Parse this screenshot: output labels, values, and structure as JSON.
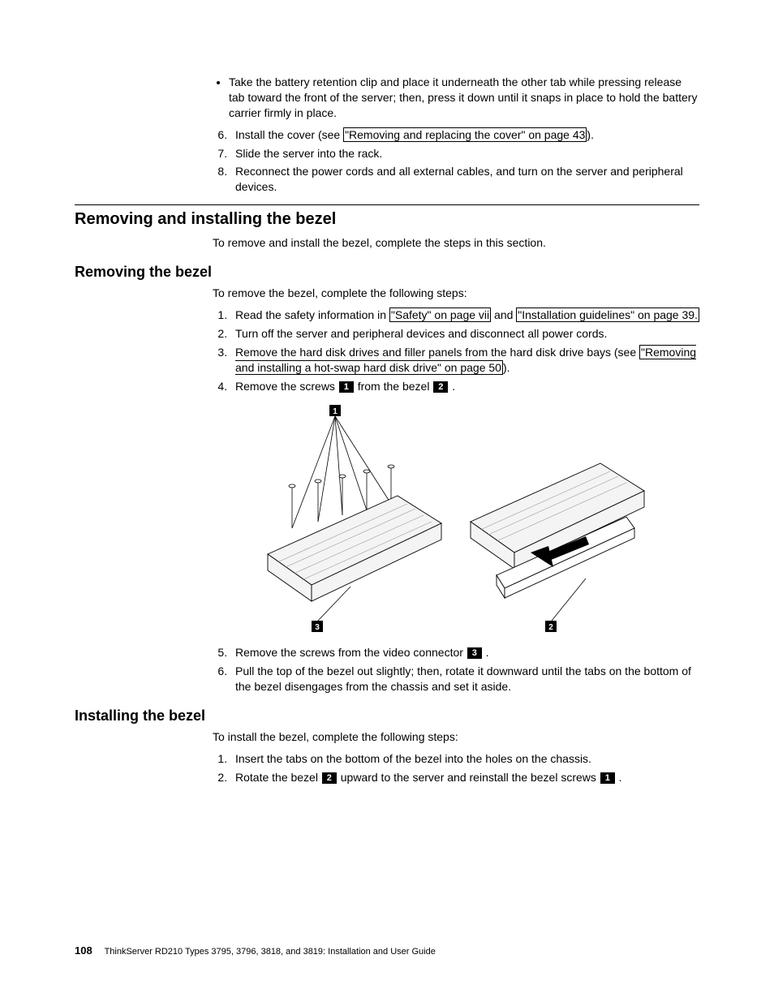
{
  "top": {
    "bullet": "Take the battery retention clip and place it underneath the other tab while pressing release tab toward the front of the server; then, press it down until it snaps in place to hold the battery carrier firmly in place.",
    "step6_a": "Install the cover (see ",
    "step6_link": "\"Removing and replacing the cover\" on page 43",
    "step6_b": ").",
    "step7": "Slide the server into the rack.",
    "step8": "Reconnect the power cords and all external cables, and turn on the server and peripheral devices."
  },
  "sec1": {
    "title": "Removing and installing the bezel",
    "intro": "To remove and install the bezel, complete the steps in this section."
  },
  "sec2": {
    "title": "Removing the bezel",
    "intro": "To remove the bezel, complete the following steps:",
    "s1_a": "Read the safety information in ",
    "s1_link1": "\"Safety\" on page vii",
    "s1_mid": " and ",
    "s1_link2": "\"Installation guidelines\" on page 39.",
    "s2": "Turn off the server and peripheral devices and disconnect all power cords.",
    "s3_a": "Remove the hard disk drives and filler panels from the hard disk drive bays (see ",
    "s3_link": "\"Removing and installing a hot-swap hard disk drive\" on page 50",
    "s3_b": ").",
    "s4_a": "Remove the screws ",
    "s4_c1": "1",
    "s4_b": " from the bezel ",
    "s4_c2": "2",
    "s4_c": " .",
    "s5_a": "Remove the screws from the video connector ",
    "s5_c1": "3",
    "s5_b": " .",
    "s6": "Pull the top of the bezel out slightly; then, rotate it downward until the tabs on the bottom of the bezel disengages from the chassis and set it aside."
  },
  "sec3": {
    "title": "Installing the bezel",
    "intro": "To install the bezel, complete the following steps:",
    "s1": "Insert the tabs on the bottom of the bezel into the holes on the chassis.",
    "s2_a": "Rotate the bezel ",
    "s2_c1": "2",
    "s2_b": " upward to the server and reinstall the bezel screws ",
    "s2_c2": "1",
    "s2_c": " ."
  },
  "fig": {
    "c1": "1",
    "c2": "2",
    "c3": "3"
  },
  "footer": {
    "page": "108",
    "text": "ThinkServer RD210 Types 3795, 3796, 3818, and 3819: Installation and User Guide"
  }
}
